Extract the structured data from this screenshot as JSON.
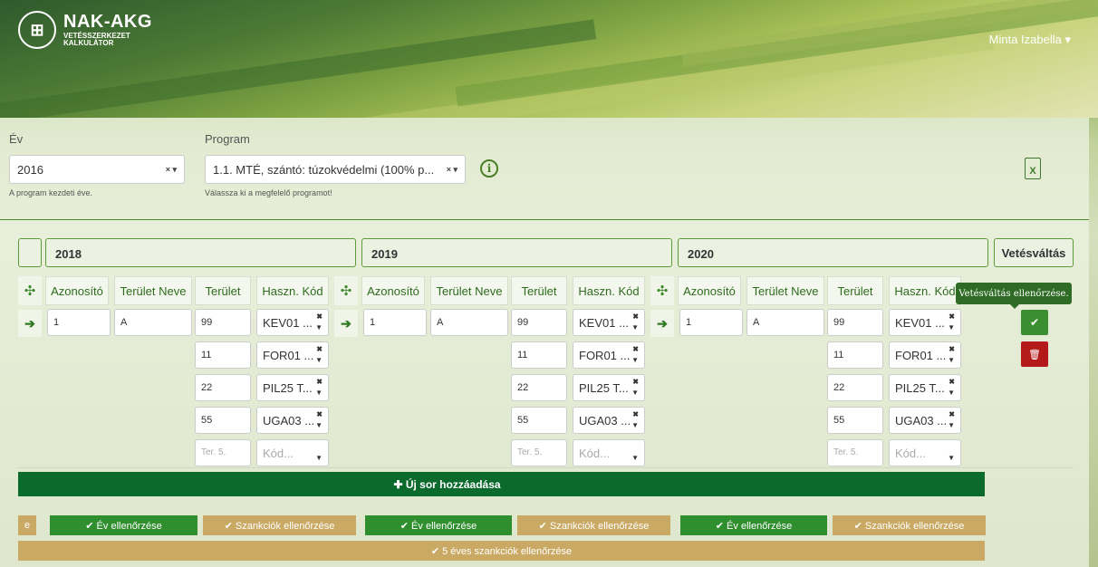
{
  "app": {
    "title": "NAK-AKG",
    "subtitle_line1": "VETÉSSZERKEZET",
    "subtitle_line2": "KALKULÁTOR",
    "logo_icon": "calculator-leaf-icon"
  },
  "user": {
    "name": "Minta Izabella ▾"
  },
  "form": {
    "year_label": "Év",
    "year_value": "2016",
    "year_help": "A program kezdeti éve.",
    "program_label": "Program",
    "program_value": "1.1. MTÉ, szántó: túzokvédelmi (100% p...",
    "program_help": "Válassza ki a megfelelő programot!",
    "clear_caret": "× ▾",
    "info_glyph": "i",
    "excel_glyph": "X"
  },
  "years": [
    "2018",
    "2019",
    "2020"
  ],
  "rotation_button": "Vetésváltás",
  "columns": [
    "Azonosító",
    "Terület Neve",
    "Terület",
    "Haszn. Kód"
  ],
  "columns_last_partial": "Haszn. Kód",
  "blocks": [
    {
      "id": "1",
      "name": "A",
      "rows": [
        {
          "area": "99",
          "code": "KEV01 ..."
        },
        {
          "area": "11",
          "code": "FOR01 ..."
        },
        {
          "area": "22",
          "code": "PIL25 T..."
        },
        {
          "area": "55",
          "code": "UGA03 ..."
        }
      ]
    },
    {
      "id": "1",
      "name": "A",
      "rows": [
        {
          "area": "99",
          "code": "KEV01 ..."
        },
        {
          "area": "11",
          "code": "FOR01 ..."
        },
        {
          "area": "22",
          "code": "PIL25 T..."
        },
        {
          "area": "55",
          "code": "UGA03 ..."
        }
      ]
    },
    {
      "id": "1",
      "name": "A",
      "rows": [
        {
          "area": "99",
          "code": "KEV01 ..."
        },
        {
          "area": "11",
          "code": "FOR01 ..."
        },
        {
          "area": "22",
          "code": "PIL25 T..."
        },
        {
          "area": "55",
          "code": "UGA03 ..."
        }
      ]
    }
  ],
  "placeholders": {
    "area": "Ter. 5.",
    "code": "Kód..."
  },
  "tooltip": "Vetésváltás ellenőrzése.",
  "add_row": "✚ Új sor hozzáadása",
  "check_year": "✔ Év ellenőrzése",
  "check_sanctions": "✔ Szankciók ellenőrzése",
  "check_5year": "✔ 5 éves szankciók ellenőrzése",
  "partial_left": "e",
  "colors": {
    "green": "#2f8f2f",
    "tan": "#c9a963",
    "dark_green": "#0b6b2c",
    "red": "#b51a1a"
  }
}
